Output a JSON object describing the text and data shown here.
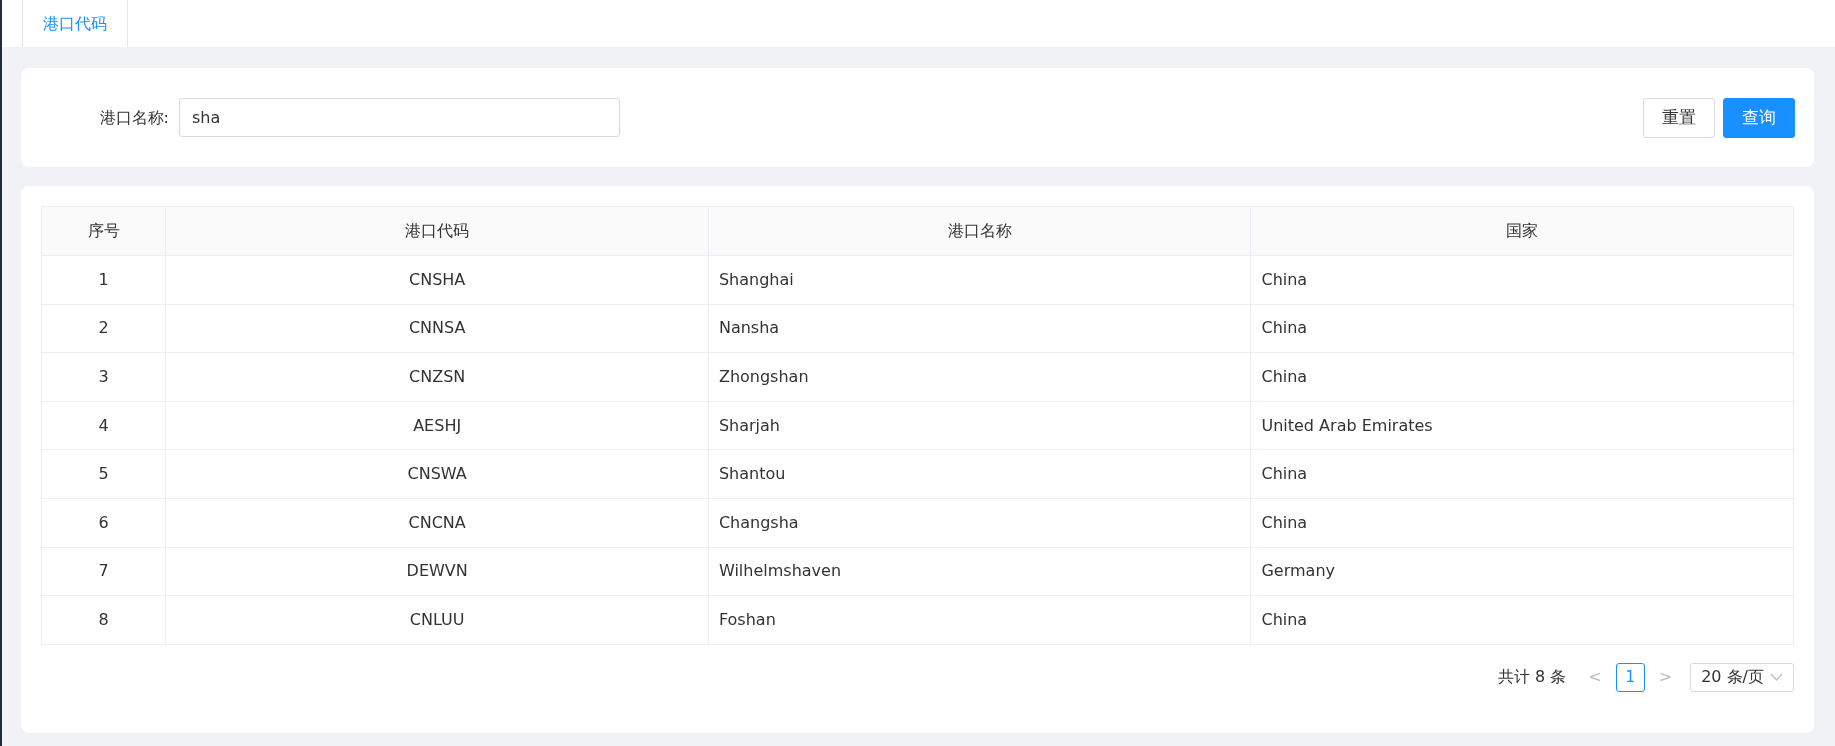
{
  "tabs": [
    {
      "label": "港口代码",
      "selected": true
    }
  ],
  "search": {
    "label": "港口名称:",
    "value": "sha",
    "buttons": [
      {
        "label": "重置",
        "kind": "default"
      },
      {
        "label": "查询",
        "kind": "primary"
      }
    ]
  },
  "table": {
    "columns": [
      "序号",
      "港口代码",
      "港口名称",
      "国家"
    ],
    "rows": [
      [
        "1",
        "CNSHA",
        "Shanghai",
        "China"
      ],
      [
        "2",
        "CNNSA",
        "Nansha",
        "China"
      ],
      [
        "3",
        "CNZSN",
        "Zhongshan",
        "China"
      ],
      [
        "4",
        "AESHJ",
        "Sharjah",
        "United Arab Emirates"
      ],
      [
        "5",
        "CNSWA",
        "Shantou",
        "China"
      ],
      [
        "6",
        "CNCNA",
        "Changsha",
        "China"
      ],
      [
        "7",
        "DEWVN",
        "Wilhelmshaven",
        "Germany"
      ],
      [
        "8",
        "CNLUU",
        "Foshan",
        "China"
      ]
    ]
  },
  "pagination": {
    "total": "共计 8 条",
    "prev": "<",
    "pages": [
      {
        "label": "1",
        "selected": true
      }
    ],
    "next": ">",
    "page_size": "20 条/页"
  }
}
